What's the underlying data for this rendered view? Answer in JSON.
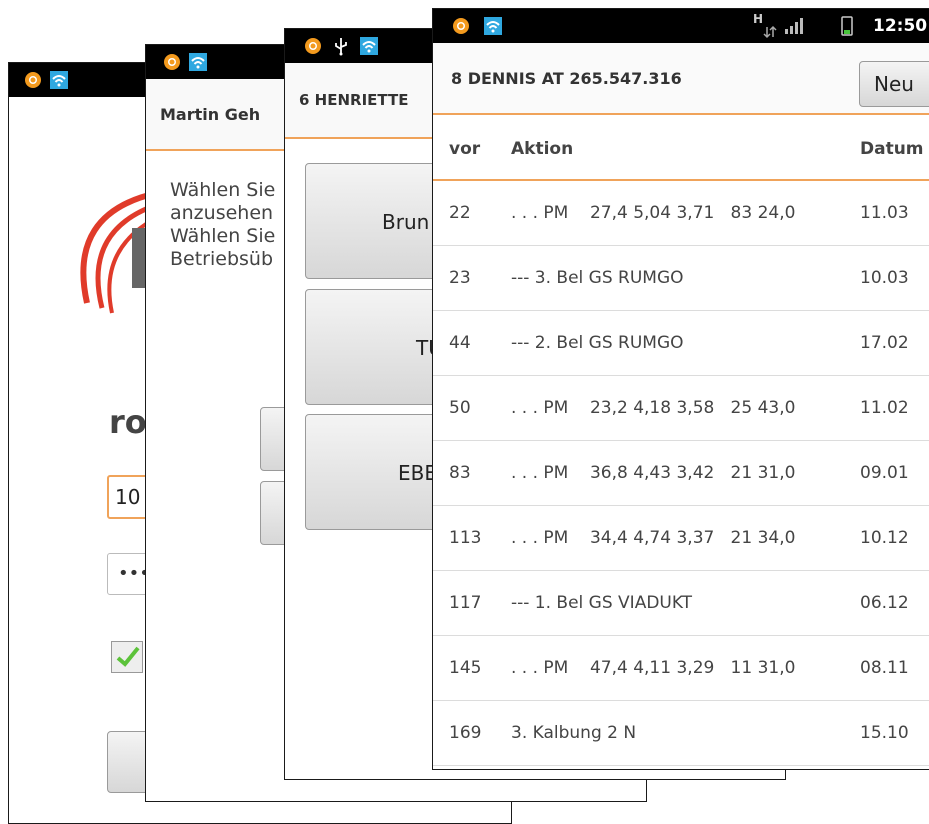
{
  "screen1": {
    "heading_partial": "ro",
    "input_value": "10",
    "password_mask": "•••"
  },
  "screen2": {
    "title": "Martin Geh",
    "text_lines": [
      "Wählen Sie",
      "anzusehen",
      "Wählen Sie",
      "Betriebsüb"
    ]
  },
  "screen3": {
    "title": "6 HENRIETTE",
    "buttons": [
      "Brun",
      "TU",
      "EBE"
    ]
  },
  "screen4": {
    "status": {
      "time": "12:50",
      "network": "H"
    },
    "title": "8 DENNIS AT 265.547.316",
    "new_button": "Neu",
    "headers": {
      "vor": "vor",
      "aktion": "Aktion",
      "datum": "Datum"
    },
    "rows": [
      {
        "vor": "22",
        "aktion": ". . . PM    27,4 5,04 3,71   83 24,0",
        "datum": "11.03"
      },
      {
        "vor": "23",
        "aktion": "--- 3. Bel GS RUMGO",
        "datum": "10.03"
      },
      {
        "vor": "44",
        "aktion": "--- 2. Bel GS RUMGO",
        "datum": "17.02"
      },
      {
        "vor": "50",
        "aktion": ". . . PM    23,2 4,18 3,58   25 43,0",
        "datum": "11.02"
      },
      {
        "vor": "83",
        "aktion": ". . . PM    36,8 4,43 3,42   21 31,0",
        "datum": "09.01"
      },
      {
        "vor": "113",
        "aktion": ". . . PM    34,4 4,74 3,37   21 34,0",
        "datum": "10.12"
      },
      {
        "vor": "117",
        "aktion": "--- 1. Bel GS VIADUKT",
        "datum": "06.12"
      },
      {
        "vor": "145",
        "aktion": ". . . PM    47,4 4,11 3,29   11 31,0",
        "datum": "08.11"
      },
      {
        "vor": "169",
        "aktion": "3. Kalbung 2 N",
        "datum": "15.10"
      }
    ]
  },
  "colors": {
    "accent": "#f0a35a",
    "statusbar": "#000000",
    "wifi": "#2fa8e0",
    "notif": "#f39a1e",
    "check": "#5cc23a"
  }
}
